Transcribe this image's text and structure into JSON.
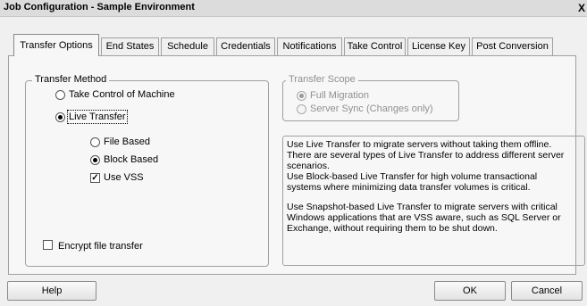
{
  "window": {
    "title": "Job Configuration - Sample Environment",
    "close_glyph": "X"
  },
  "tabs": [
    {
      "label": "Transfer Options",
      "active": true
    },
    {
      "label": "End States"
    },
    {
      "label": "Schedule"
    },
    {
      "label": "Credentials"
    },
    {
      "label": "Notifications"
    },
    {
      "label": "Take Control"
    },
    {
      "label": "License Key"
    },
    {
      "label": "Post Conversion"
    }
  ],
  "transfer_method": {
    "legend": "Transfer Method",
    "take_control_label": "Take Control of Machine",
    "take_control_selected": false,
    "live_transfer_label": "Live Transfer",
    "live_transfer_selected": true,
    "file_based_label": "File Based",
    "file_based_selected": false,
    "block_based_label": "Block Based",
    "block_based_selected": true,
    "use_vss_label": "Use VSS",
    "use_vss_checked": true,
    "encrypt_label": "Encrypt file transfer",
    "encrypt_checked": false
  },
  "transfer_scope": {
    "legend": "Transfer Scope",
    "full_migration_label": "Full Migration",
    "full_migration_selected": true,
    "server_sync_label": "Server Sync (Changes only)",
    "server_sync_selected": false,
    "enabled": false
  },
  "description": {
    "line1": "Use Live Transfer to migrate servers without taking them offline.",
    "line2": "There are several types of Live Transfer to address different server",
    "line3": "scenarios.",
    "line4": "Use Block-based Live Transfer for high volume transactional",
    "line5": "systems where minimizing data transfer volumes is critical.",
    "line6": "Use Snapshot-based Live Transfer to migrate servers with critical",
    "line7": "Windows applications that are VSS aware, such as SQL Server or",
    "line8": "Exchange, without requiring them to be shut down."
  },
  "buttons": {
    "help": "Help",
    "ok": "OK",
    "cancel": "Cancel"
  },
  "glyphs": {
    "check": "✓"
  }
}
